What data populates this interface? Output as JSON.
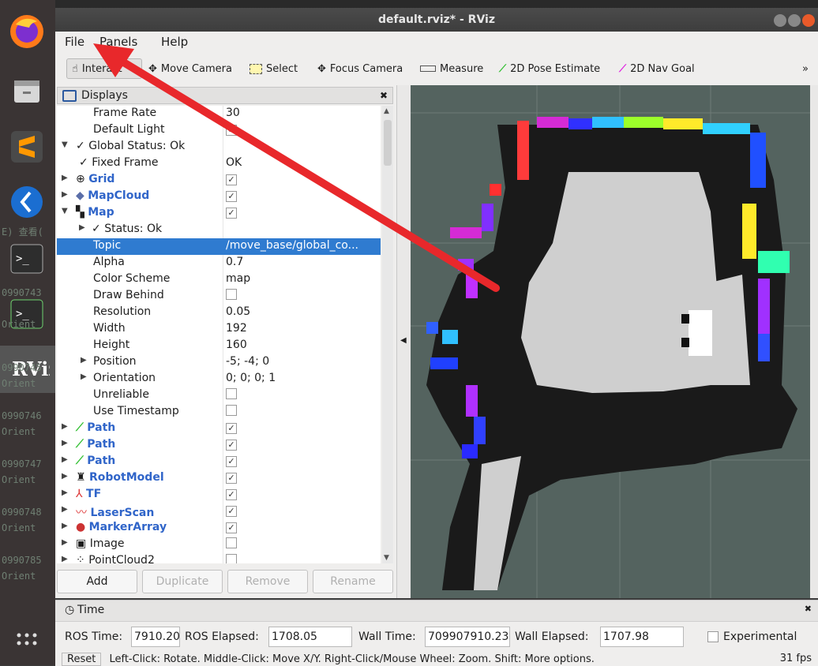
{
  "window": {
    "title": "default.rviz* - RViz"
  },
  "menu": {
    "file": "File",
    "panels": "Panels",
    "help": "Help"
  },
  "toolbar": {
    "interact": "Interact",
    "move_camera": "Move Camera",
    "select": "Select",
    "focus_camera": "Focus Camera",
    "measure": "Measure",
    "pose_estimate": "2D Pose Estimate",
    "nav_goal": "2D Nav Goal",
    "overflow": "»"
  },
  "displays": {
    "title": "Displays",
    "rows": [
      {
        "name": "Frame Rate",
        "value": "30"
      },
      {
        "name": "Default Light",
        "value": "✓"
      },
      {
        "name": "Global Status: Ok",
        "value": ""
      },
      {
        "name": "Fixed Frame",
        "value": "OK"
      },
      {
        "name": "Grid",
        "value": "✓"
      },
      {
        "name": "MapCloud",
        "value": "✓"
      },
      {
        "name": "Map",
        "value": "✓"
      },
      {
        "name": "Status: Ok",
        "value": ""
      },
      {
        "name": "Topic",
        "value": "/move_base/global_co..."
      },
      {
        "name": "Alpha",
        "value": "0.7"
      },
      {
        "name": "Color Scheme",
        "value": "map"
      },
      {
        "name": "Draw Behind",
        "value": ""
      },
      {
        "name": "Resolution",
        "value": "0.05"
      },
      {
        "name": "Width",
        "value": "192"
      },
      {
        "name": "Height",
        "value": "160"
      },
      {
        "name": "Position",
        "value": "-5; -4; 0"
      },
      {
        "name": "Orientation",
        "value": "0; 0; 0; 1"
      },
      {
        "name": "Unreliable",
        "value": ""
      },
      {
        "name": "Use Timestamp",
        "value": ""
      },
      {
        "name": "Path",
        "value": "✓"
      },
      {
        "name": "Path",
        "value": "✓"
      },
      {
        "name": "Path",
        "value": "✓"
      },
      {
        "name": "RobotModel",
        "value": "✓"
      },
      {
        "name": "TF",
        "value": "✓"
      },
      {
        "name": "LaserScan",
        "value": "✓"
      },
      {
        "name": "MarkerArray",
        "value": "✓"
      },
      {
        "name": "Image",
        "value": ""
      },
      {
        "name": "PointCloud2",
        "value": ""
      }
    ],
    "buttons": {
      "add": "Add",
      "duplicate": "Duplicate",
      "remove": "Remove",
      "rename": "Rename"
    }
  },
  "time": {
    "title": "Time",
    "ros_time_label": "ROS Time:",
    "ros_time": "7910.20",
    "ros_elapsed_label": "ROS Elapsed:",
    "ros_elapsed": "1708.05",
    "wall_time_label": "Wall Time:",
    "wall_time": "709907910.23",
    "wall_elapsed_label": "Wall Elapsed:",
    "wall_elapsed": "1707.98",
    "experimental": "Experimental"
  },
  "statusbar": {
    "reset": "Reset",
    "hint": "Left-Click: Rotate. Middle-Click: Move X/Y. Right-Click/Mouse Wheel: Zoom. Shift: More options.",
    "fps": "31 fps"
  },
  "terminal_bg": [
    "E) 查看(",
    "0990743",
    "Orient",
    "0990745",
    "Orient",
    "0990746",
    "Orient",
    "0990747",
    "Orient",
    "0990748",
    "Orient",
    "0990785",
    "Orient"
  ],
  "colors": {
    "selection": "#2f7bd0",
    "accent_blue": "#3065c9",
    "arrow": "#e8282b",
    "map_bg": "#54635f"
  }
}
